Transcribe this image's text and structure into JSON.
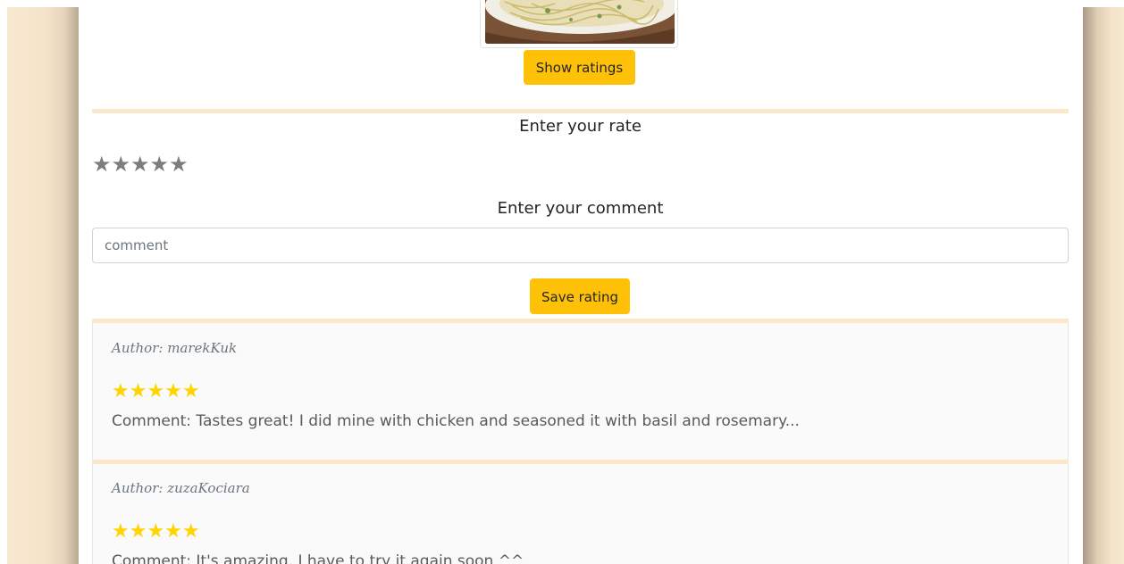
{
  "recipe": {
    "show_ratings_label": "Show ratings"
  },
  "rate_form": {
    "rate_heading": "Enter your rate",
    "stars": [
      "★",
      "★",
      "★",
      "★",
      "★"
    ],
    "comment_heading": "Enter your comment",
    "comment_placeholder": "comment",
    "comment_value": "",
    "save_label": "Save rating"
  },
  "ratings": [
    {
      "author": "Author: marekKuk",
      "stars": "★★★★★",
      "score": 5,
      "comment": "Comment: Tastes great! I did mine with chicken and seasoned it with basil and rosemary..."
    },
    {
      "author": "Author: zuzaKociara",
      "stars": "★★★★★",
      "score": 5,
      "comment": "Comment: It's amazing, I have to try it again soon ^^"
    }
  ],
  "colors": {
    "accent_button": "#ffc107",
    "divider": "#fbe8cc",
    "star_filled": "#ffd400",
    "star_empty": "#7d7d7d",
    "side_background": "#f4e3c8"
  }
}
